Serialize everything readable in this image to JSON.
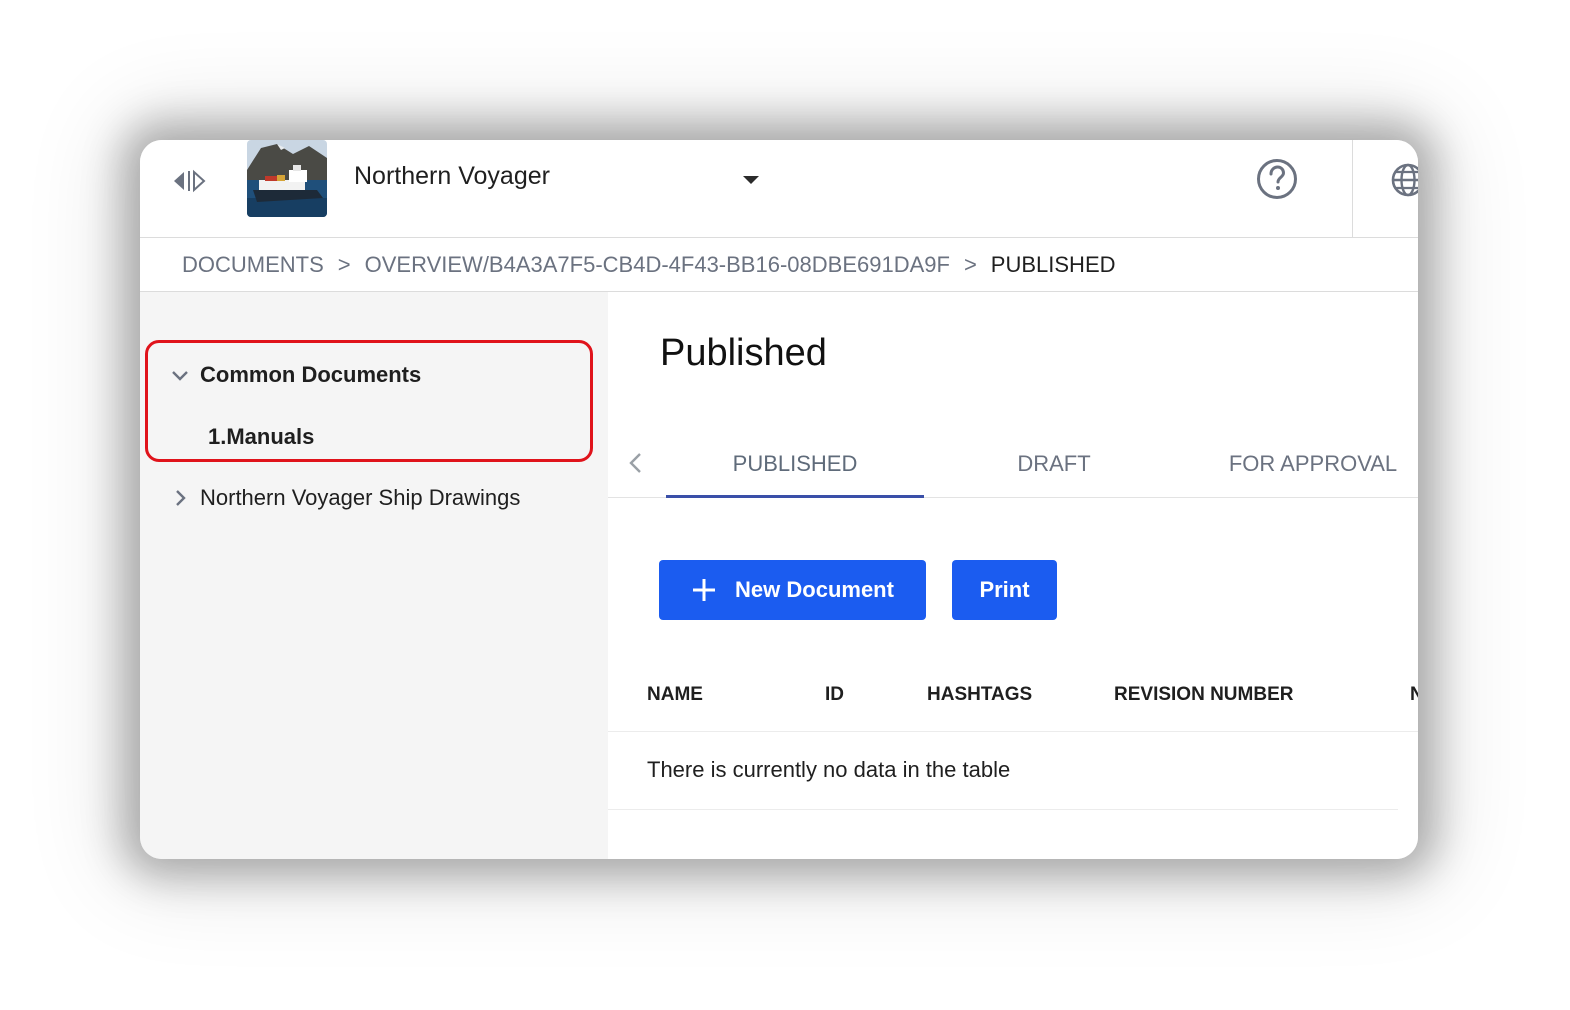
{
  "header": {
    "vessel_name": "Northern Voyager"
  },
  "breadcrumb": {
    "items": [
      "DOCUMENTS",
      "OVERVIEW/B4A3A7F5-CB4D-4F43-BB16-08DBE691DA9F",
      "PUBLISHED"
    ],
    "separator": ">"
  },
  "sidebar": {
    "tree": [
      {
        "label": "Common Documents",
        "expanded": true,
        "children": [
          {
            "label": "1.Manuals",
            "selected": true
          }
        ]
      },
      {
        "label": "Northern Voyager Ship Drawings",
        "expanded": false
      }
    ],
    "highlight_color": "#e0131b"
  },
  "main": {
    "title": "Published",
    "tabs": [
      {
        "label": "PUBLISHED",
        "active": true
      },
      {
        "label": "DRAFT",
        "active": false
      },
      {
        "label": "FOR APPROVAL",
        "active": false
      }
    ],
    "buttons": {
      "new_document": "New Document",
      "print": "Print"
    },
    "table": {
      "columns": [
        "NAME",
        "ID",
        "HASHTAGS",
        "REVISION NUMBER",
        "N"
      ],
      "empty_message": "There is currently no data in the table"
    }
  },
  "colors": {
    "primary": "#1b5cf0",
    "tab_underline": "#3a4fa8",
    "sidebar_bg": "#f5f5f5"
  },
  "icons": [
    "collapse-sidebar-icon",
    "vessel-thumbnail",
    "caret-down-icon",
    "help-icon",
    "globe-icon",
    "chevron-down-icon",
    "chevron-right-icon",
    "chevron-left-icon",
    "plus-icon"
  ]
}
